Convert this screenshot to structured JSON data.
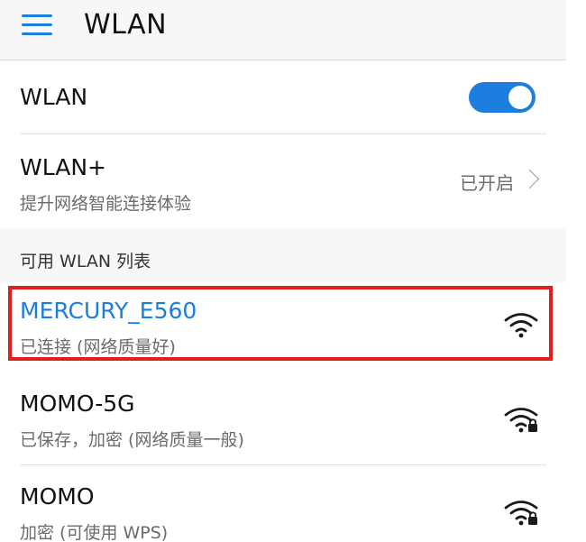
{
  "header": {
    "title": "WLAN"
  },
  "wlan_toggle": {
    "label": "WLAN",
    "enabled": true
  },
  "wlan_plus": {
    "title": "WLAN+",
    "subtitle": "提升网络智能连接体验",
    "status": "已开启"
  },
  "available": {
    "header": "可用 WLAN 列表",
    "networks": [
      {
        "name": "MERCURY_E560",
        "status": "已连接 (网络质量好)",
        "connected": true,
        "secured": false,
        "icon": "wifi-icon"
      },
      {
        "name": "MOMO-5G",
        "status": "已保存，加密 (网络质量一般)",
        "connected": false,
        "secured": true,
        "icon": "wifi-lock-icon"
      },
      {
        "name": "MOMO",
        "status": "加密 (可使用 WPS)",
        "connected": false,
        "secured": true,
        "icon": "wifi-lock-icon"
      }
    ]
  },
  "colors": {
    "accent": "#1e7ee0",
    "highlight": "#e0201f",
    "text": "#111111",
    "secondary_text": "#6b6b6b",
    "header_bg": "#f7f7f7"
  }
}
